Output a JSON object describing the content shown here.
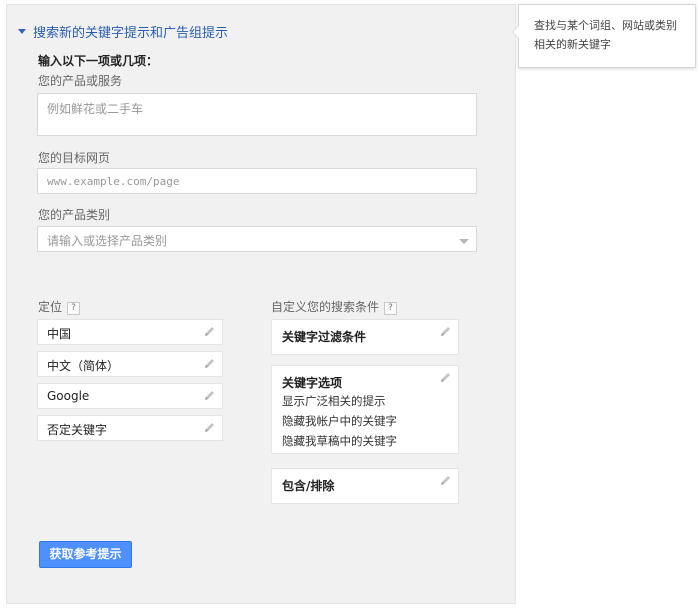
{
  "section": {
    "title": "搜索新的关键字提示和广告组提示"
  },
  "form": {
    "intro": "输入以下一项或几项：",
    "product_label": "您的产品或服务",
    "product_placeholder": "例如鲜花或二手车",
    "landing_label": "您的目标网页",
    "landing_placeholder": "www.example.com/page",
    "category_label": "您的产品类别",
    "category_placeholder": "请输入或选择产品类别"
  },
  "targeting": {
    "label": "定位",
    "help": "?",
    "items": [
      "中国",
      "中文（简体）",
      "Google",
      "否定关键字"
    ]
  },
  "custom": {
    "label": "自定义您的搜索条件",
    "help": "?",
    "keyword_filters": "关键字过滤条件",
    "keyword_options": {
      "title": "关键字选项",
      "lines": [
        "显示广泛相关的提示",
        "隐藏我帐户中的关键字",
        "隐藏我草稿中的关键字"
      ]
    },
    "include_exclude": "包含/排除"
  },
  "button": {
    "label": "获取参考提示"
  },
  "tooltip": {
    "text": "查找与某个词组、网站或类别相关的新关键字"
  },
  "icons": {
    "edit": "pencil-icon",
    "expand": "caret-down-icon",
    "help": "help-icon"
  },
  "colors": {
    "link": "#2a5db0",
    "button": "#4d90fe",
    "panel": "#f1f1f1"
  }
}
